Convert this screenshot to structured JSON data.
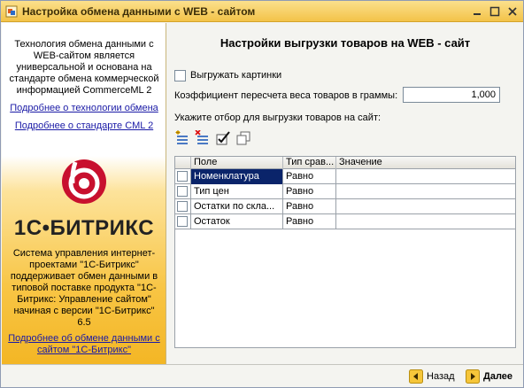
{
  "window": {
    "title": "Настройка обмена данными с WEB - сайтом"
  },
  "sidebar": {
    "intro": "Технология обмена данными с WEB-сайтом является универсальной и основана на стандарте обмена коммерческой информацией CommerceML 2",
    "link_technology": "Подробнее о технологии обмена",
    "link_standard": "Подробнее о стандарте CML 2",
    "brand": "1С•БИТРИКС",
    "description": "Система управления интернет-проектами \"1С-Битрикс\" поддерживает обмен данными в типовой поставке продукта \"1С-Битрикс: Управление сайтом\" начиная с версии \"1С-Битрикс\" 6.5",
    "link_exchange": "Подробнее об обмене данными с сайтом \"1С-Битрикс\""
  },
  "main": {
    "heading": "Настройки выгрузки товаров на WEB - сайт",
    "export_pictures_label": "Выгружать картинки",
    "export_pictures_checked": false,
    "coefficient_label": "Коэффициент пересчета веса товаров в граммы:",
    "coefficient_value": "1,000",
    "filter_label": "Укажите отбор для выгрузки товаров на сайт:",
    "toolbar": [
      "add-filter-icon",
      "delete-filter-icon",
      "check-all-icon",
      "copy-icon"
    ],
    "grid": {
      "columns": [
        "Поле",
        "Тип срав...",
        "Значение"
      ],
      "rows": [
        {
          "field": "Номенклатура",
          "comparison": "Равно",
          "value": "",
          "checked": false,
          "selected": true
        },
        {
          "field": "Тип цен",
          "comparison": "Равно",
          "value": "",
          "checked": false,
          "selected": false
        },
        {
          "field": "Остатки по скла...",
          "comparison": "Равно",
          "value": "",
          "checked": false,
          "selected": false
        },
        {
          "field": "Остаток",
          "comparison": "Равно",
          "value": "",
          "checked": false,
          "selected": false
        }
      ]
    }
  },
  "footer": {
    "back_label": "Назад",
    "next_label": "Далее"
  },
  "colors": {
    "title_bar": "#f3c349",
    "selection": "#0a246a",
    "brand_red": "#c8102e",
    "link": "#1a1aa6"
  }
}
